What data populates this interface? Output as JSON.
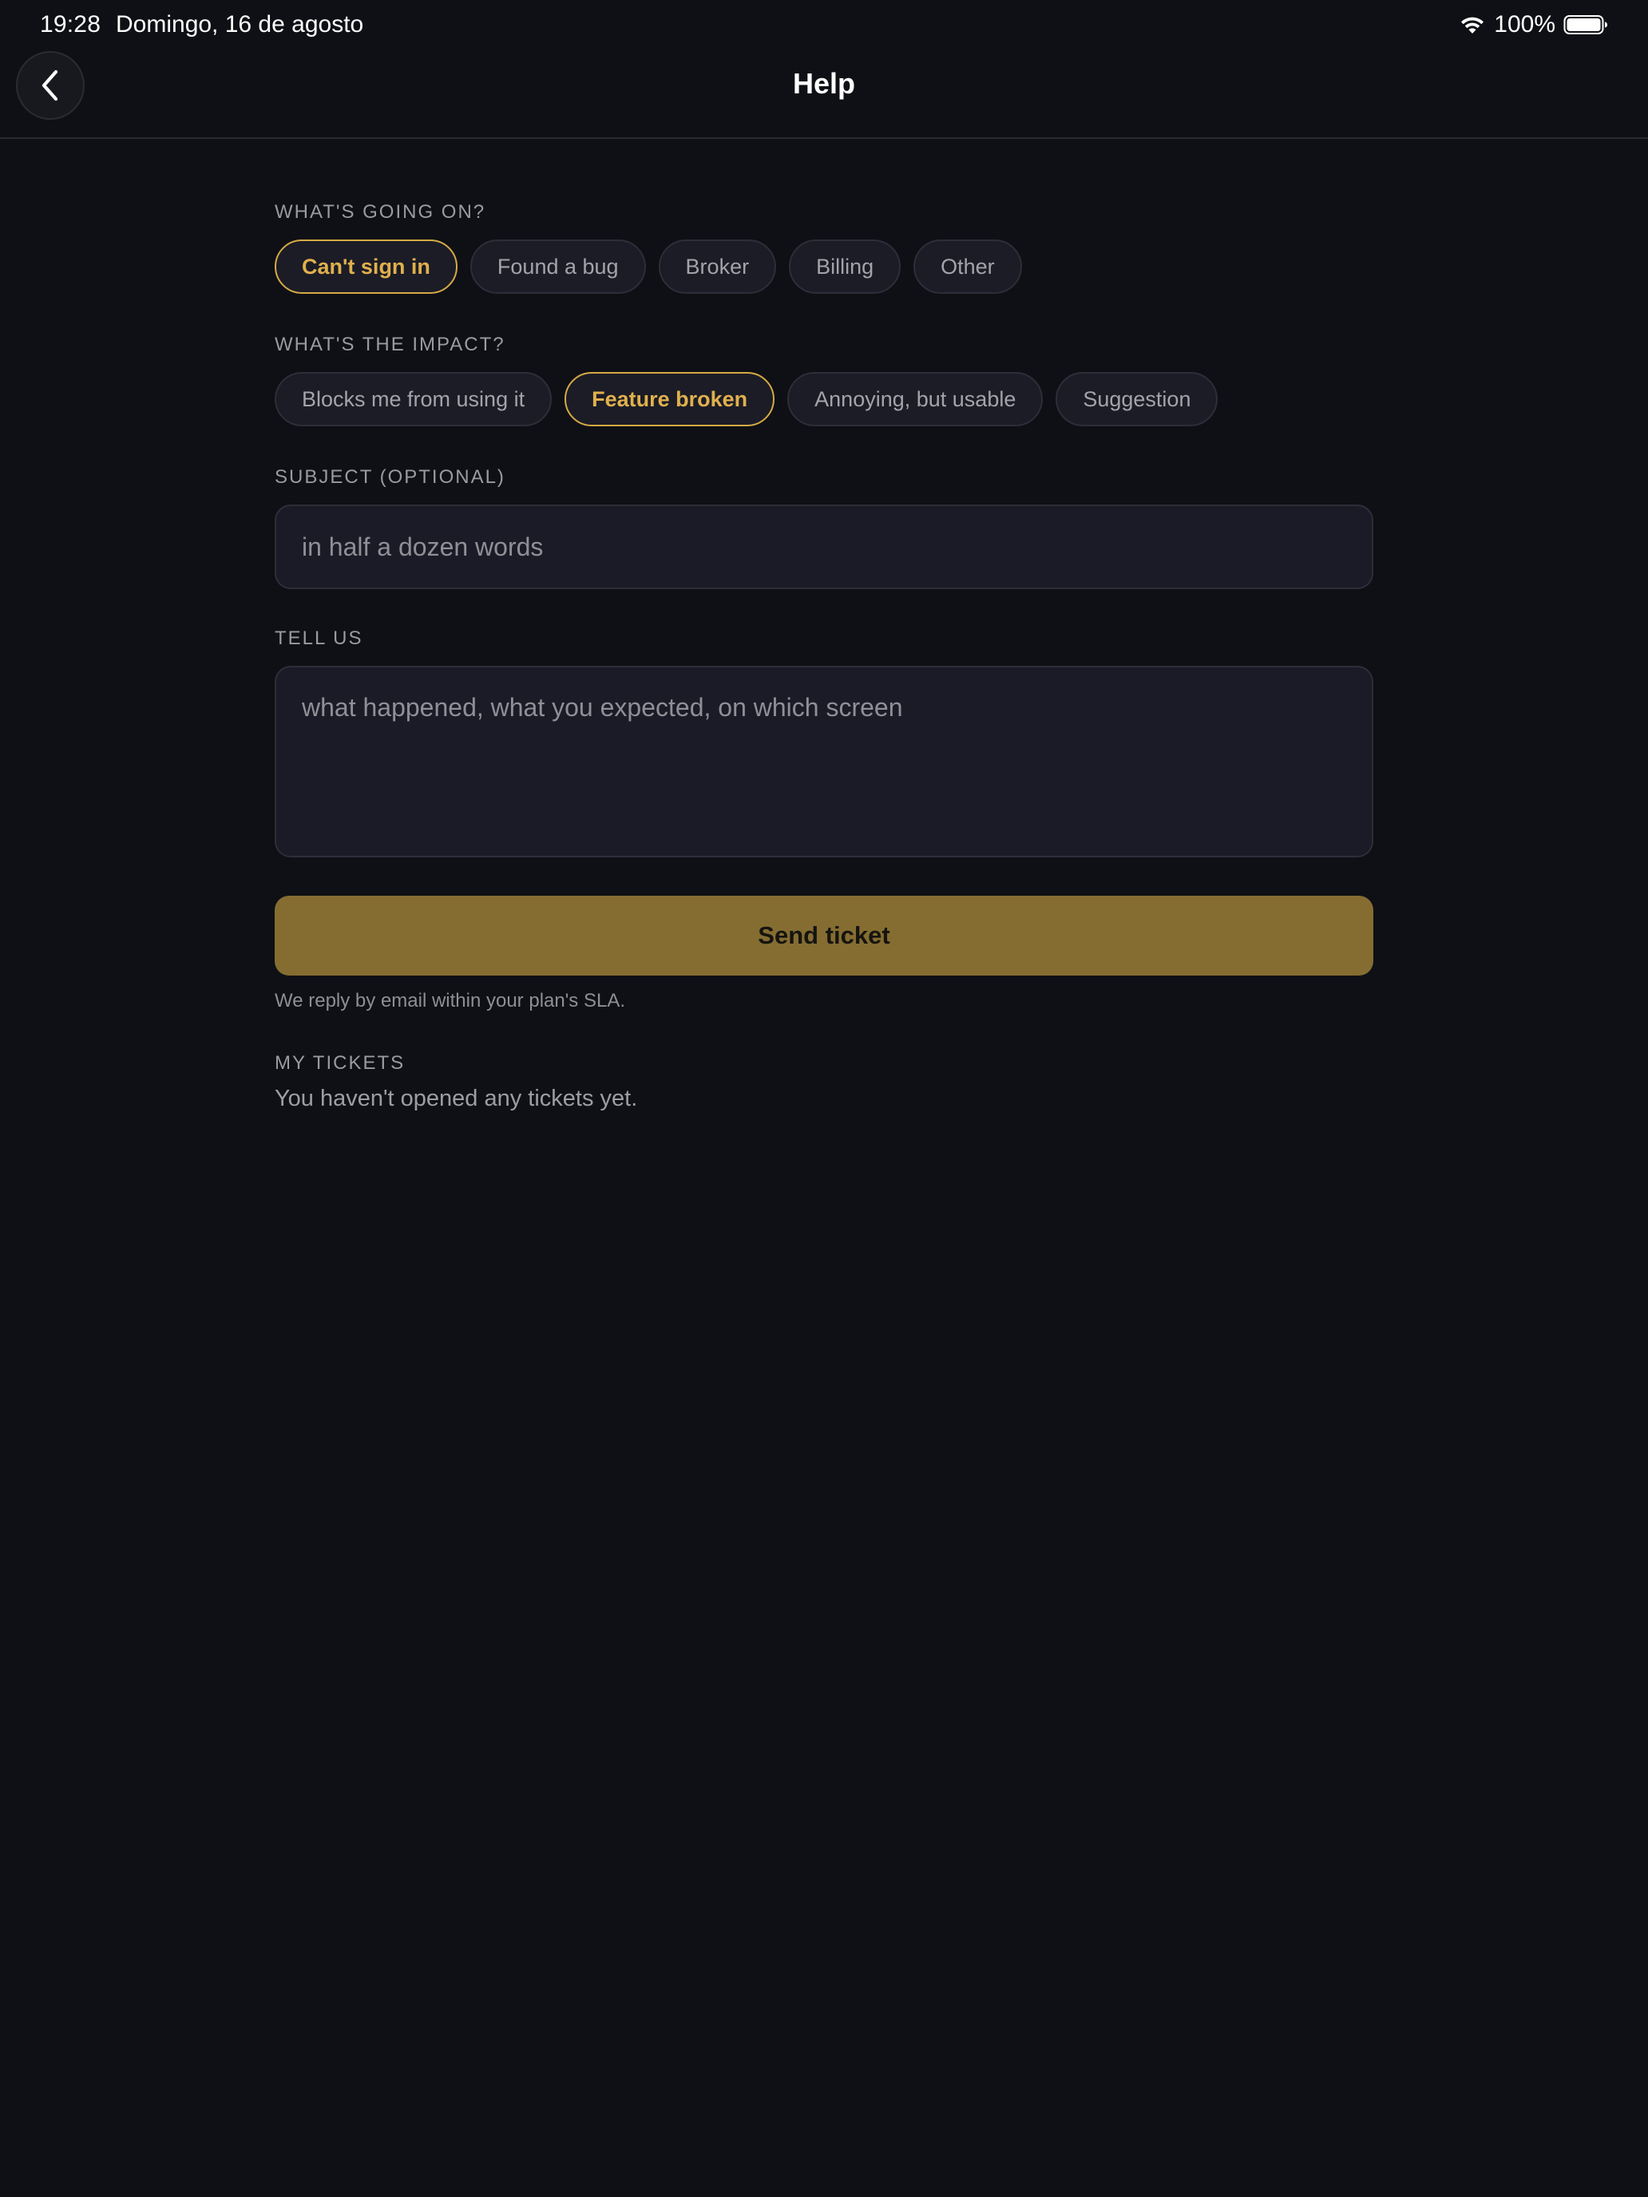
{
  "status_bar": {
    "time": "19:28",
    "date": "Domingo, 16 de agosto",
    "battery": "100%",
    "wifi_icon": "wifi-icon",
    "battery_icon": "battery-icon"
  },
  "header": {
    "title": "Help",
    "back_icon": "chevron-left-icon"
  },
  "form": {
    "category": {
      "label": "WHAT'S GOING ON?",
      "options": [
        "Can't sign in",
        "Found a bug",
        "Broker",
        "Billing",
        "Other"
      ],
      "selected": "Can't sign in"
    },
    "impact": {
      "label": "WHAT'S THE IMPACT?",
      "options": [
        "Blocks me from using it",
        "Feature broken",
        "Annoying, but usable",
        "Suggestion"
      ],
      "selected": "Feature broken"
    },
    "subject": {
      "label": "SUBJECT (OPTIONAL)",
      "value": "",
      "placeholder": "in half a dozen words"
    },
    "details": {
      "label": "TELL US",
      "value": "",
      "placeholder": "what happened, what you expected, on which screen"
    },
    "submit_label": "Send ticket",
    "reply_note": "We reply by email within your plan's SLA."
  },
  "tickets": {
    "label": "MY TICKETS",
    "empty_text": "You haven't opened any tickets yet."
  },
  "colors": {
    "background": "#0f1015",
    "accent": "#d6aa45",
    "button": "#856d32",
    "field": "#1a1b26"
  }
}
